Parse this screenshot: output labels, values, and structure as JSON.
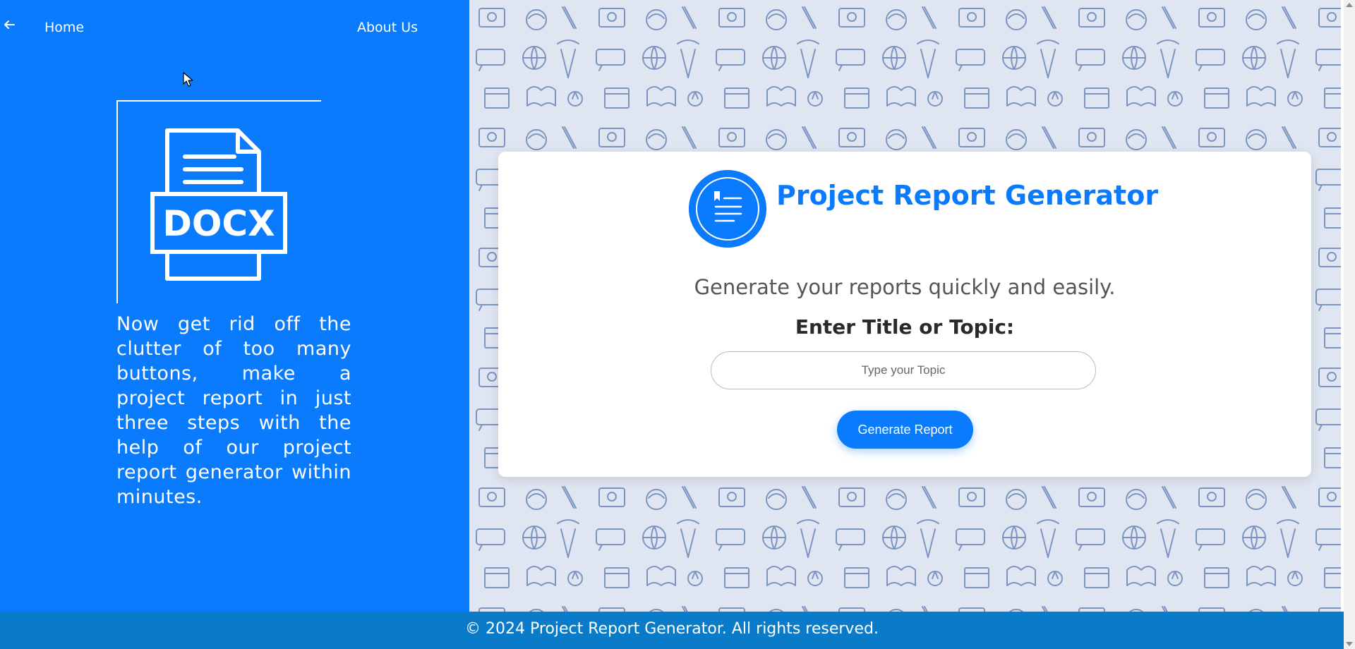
{
  "nav": {
    "home_label": "Home",
    "about_label": "About Us"
  },
  "hero": {
    "illustration_text": "DOCX",
    "description": "Now get rid off the clutter of too many buttons, make a project report in just three steps with the help of our project report generator within minutes."
  },
  "card": {
    "title": "Project Report Generator",
    "subtitle": "Generate your reports quickly and easily.",
    "field_label": "Enter Title or Topic:",
    "input_placeholder": "Type your Topic",
    "input_value": "",
    "button_label": "Generate Report"
  },
  "footer": {
    "text": "© 2024 Project Report Generator. All rights reserved."
  },
  "colors": {
    "primary": "#0a7bfd",
    "footer": "#0a7bc9",
    "pattern_bg": "#dfe6f2",
    "pattern_stroke": "#5a78b0"
  },
  "icons": [
    "arrow-left-icon",
    "mouse-cursor-icon",
    "docx-file-icon",
    "report-logo-icon"
  ]
}
